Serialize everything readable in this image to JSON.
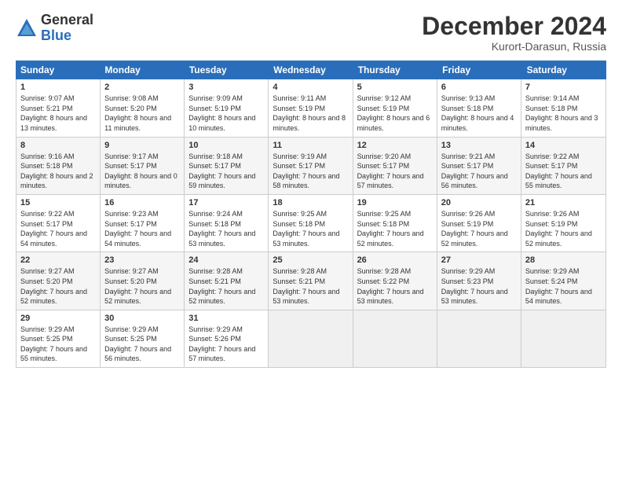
{
  "logo": {
    "general": "General",
    "blue": "Blue"
  },
  "header": {
    "month": "December 2024",
    "location": "Kurort-Darasun, Russia"
  },
  "days": [
    "Sunday",
    "Monday",
    "Tuesday",
    "Wednesday",
    "Thursday",
    "Friday",
    "Saturday"
  ],
  "weeks": [
    [
      {
        "day": "1",
        "rise": "9:07 AM",
        "set": "5:21 PM",
        "daylight": "8 hours and 13 minutes.",
        "shaded": false
      },
      {
        "day": "2",
        "rise": "9:08 AM",
        "set": "5:20 PM",
        "daylight": "8 hours and 11 minutes.",
        "shaded": false
      },
      {
        "day": "3",
        "rise": "9:09 AM",
        "set": "5:19 PM",
        "daylight": "8 hours and 10 minutes.",
        "shaded": false
      },
      {
        "day": "4",
        "rise": "9:11 AM",
        "set": "5:19 PM",
        "daylight": "8 hours and 8 minutes.",
        "shaded": false
      },
      {
        "day": "5",
        "rise": "9:12 AM",
        "set": "5:19 PM",
        "daylight": "8 hours and 6 minutes.",
        "shaded": false
      },
      {
        "day": "6",
        "rise": "9:13 AM",
        "set": "5:18 PM",
        "daylight": "8 hours and 4 minutes.",
        "shaded": false
      },
      {
        "day": "7",
        "rise": "9:14 AM",
        "set": "5:18 PM",
        "daylight": "8 hours and 3 minutes.",
        "shaded": false
      }
    ],
    [
      {
        "day": "8",
        "rise": "9:16 AM",
        "set": "5:18 PM",
        "daylight": "8 hours and 2 minutes.",
        "shaded": true
      },
      {
        "day": "9",
        "rise": "9:17 AM",
        "set": "5:17 PM",
        "daylight": "8 hours and 0 minutes.",
        "shaded": true
      },
      {
        "day": "10",
        "rise": "9:18 AM",
        "set": "5:17 PM",
        "daylight": "7 hours and 59 minutes.",
        "shaded": true
      },
      {
        "day": "11",
        "rise": "9:19 AM",
        "set": "5:17 PM",
        "daylight": "7 hours and 58 minutes.",
        "shaded": true
      },
      {
        "day": "12",
        "rise": "9:20 AM",
        "set": "5:17 PM",
        "daylight": "7 hours and 57 minutes.",
        "shaded": true
      },
      {
        "day": "13",
        "rise": "9:21 AM",
        "set": "5:17 PM",
        "daylight": "7 hours and 56 minutes.",
        "shaded": true
      },
      {
        "day": "14",
        "rise": "9:22 AM",
        "set": "5:17 PM",
        "daylight": "7 hours and 55 minutes.",
        "shaded": true
      }
    ],
    [
      {
        "day": "15",
        "rise": "9:22 AM",
        "set": "5:17 PM",
        "daylight": "7 hours and 54 minutes.",
        "shaded": false
      },
      {
        "day": "16",
        "rise": "9:23 AM",
        "set": "5:17 PM",
        "daylight": "7 hours and 54 minutes.",
        "shaded": false
      },
      {
        "day": "17",
        "rise": "9:24 AM",
        "set": "5:18 PM",
        "daylight": "7 hours and 53 minutes.",
        "shaded": false
      },
      {
        "day": "18",
        "rise": "9:25 AM",
        "set": "5:18 PM",
        "daylight": "7 hours and 53 minutes.",
        "shaded": false
      },
      {
        "day": "19",
        "rise": "9:25 AM",
        "set": "5:18 PM",
        "daylight": "7 hours and 52 minutes.",
        "shaded": false
      },
      {
        "day": "20",
        "rise": "9:26 AM",
        "set": "5:19 PM",
        "daylight": "7 hours and 52 minutes.",
        "shaded": false
      },
      {
        "day": "21",
        "rise": "9:26 AM",
        "set": "5:19 PM",
        "daylight": "7 hours and 52 minutes.",
        "shaded": false
      }
    ],
    [
      {
        "day": "22",
        "rise": "9:27 AM",
        "set": "5:20 PM",
        "daylight": "7 hours and 52 minutes.",
        "shaded": true
      },
      {
        "day": "23",
        "rise": "9:27 AM",
        "set": "5:20 PM",
        "daylight": "7 hours and 52 minutes.",
        "shaded": true
      },
      {
        "day": "24",
        "rise": "9:28 AM",
        "set": "5:21 PM",
        "daylight": "7 hours and 52 minutes.",
        "shaded": true
      },
      {
        "day": "25",
        "rise": "9:28 AM",
        "set": "5:21 PM",
        "daylight": "7 hours and 53 minutes.",
        "shaded": true
      },
      {
        "day": "26",
        "rise": "9:28 AM",
        "set": "5:22 PM",
        "daylight": "7 hours and 53 minutes.",
        "shaded": true
      },
      {
        "day": "27",
        "rise": "9:29 AM",
        "set": "5:23 PM",
        "daylight": "7 hours and 53 minutes.",
        "shaded": true
      },
      {
        "day": "28",
        "rise": "9:29 AM",
        "set": "5:24 PM",
        "daylight": "7 hours and 54 minutes.",
        "shaded": true
      }
    ],
    [
      {
        "day": "29",
        "rise": "9:29 AM",
        "set": "5:25 PM",
        "daylight": "7 hours and 55 minutes.",
        "shaded": false
      },
      {
        "day": "30",
        "rise": "9:29 AM",
        "set": "5:25 PM",
        "daylight": "7 hours and 56 minutes.",
        "shaded": false
      },
      {
        "day": "31",
        "rise": "9:29 AM",
        "set": "5:26 PM",
        "daylight": "7 hours and 57 minutes.",
        "shaded": false
      },
      {
        "day": "",
        "rise": "",
        "set": "",
        "daylight": "",
        "shaded": false,
        "empty": true
      },
      {
        "day": "",
        "rise": "",
        "set": "",
        "daylight": "",
        "shaded": false,
        "empty": true
      },
      {
        "day": "",
        "rise": "",
        "set": "",
        "daylight": "",
        "shaded": false,
        "empty": true
      },
      {
        "day": "",
        "rise": "",
        "set": "",
        "daylight": "",
        "shaded": false,
        "empty": true
      }
    ]
  ]
}
